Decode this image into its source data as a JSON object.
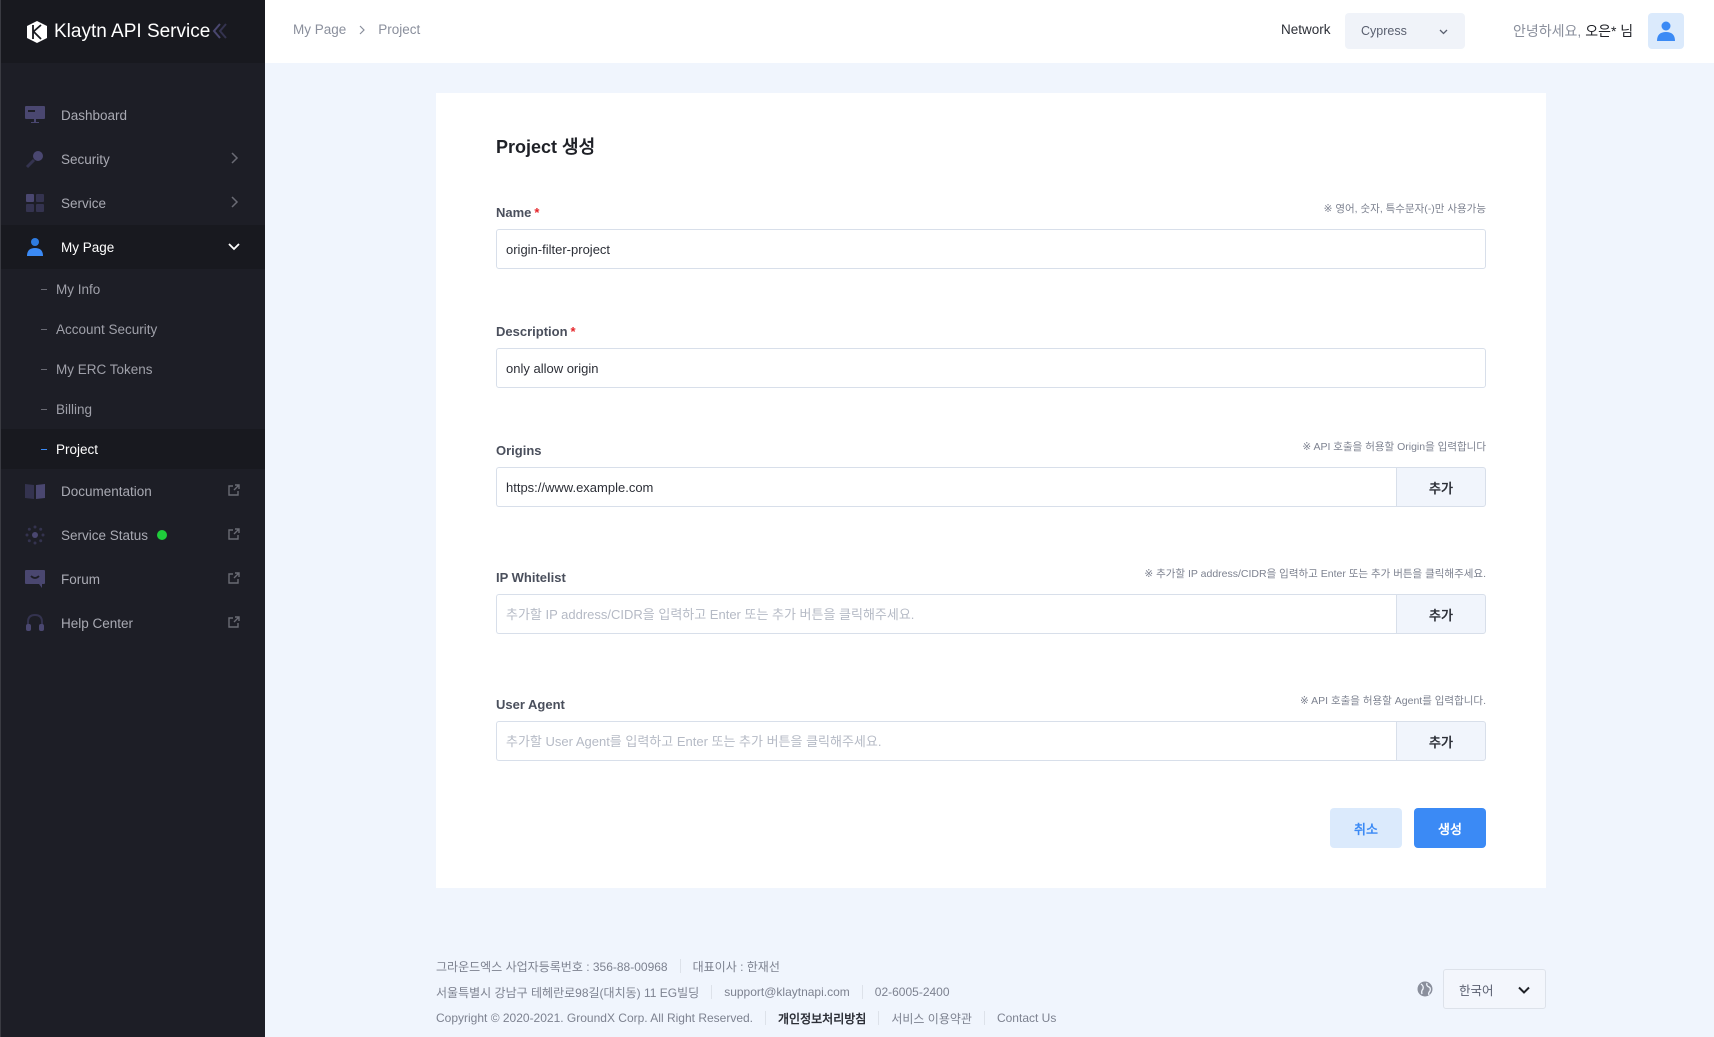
{
  "app": {
    "title": "Klaytn API Service"
  },
  "sidebar": {
    "items": [
      {
        "label": "Dashboard"
      },
      {
        "label": "Security"
      },
      {
        "label": "Service"
      },
      {
        "label": "My Page"
      }
    ],
    "subitems": [
      {
        "label": "My Info"
      },
      {
        "label": "Account Security"
      },
      {
        "label": "My ERC Tokens"
      },
      {
        "label": "Billing"
      },
      {
        "label": "Project"
      }
    ],
    "external": [
      {
        "label": "Documentation"
      },
      {
        "label": "Service Status"
      },
      {
        "label": "Forum"
      },
      {
        "label": "Help Center"
      }
    ],
    "status_color": "#1fcc3b"
  },
  "header": {
    "breadcrumb": [
      "My Page",
      "Project"
    ],
    "network_label": "Network",
    "network_value": "Cypress",
    "greeting": "안녕하세요,",
    "user_name": "오은* 님"
  },
  "form": {
    "title": "Project 생성",
    "name": {
      "label": "Name",
      "required": "*",
      "hint": "※ 영어, 숫자, 특수문자(-)만 사용가능",
      "value": "origin-filter-project"
    },
    "description": {
      "label": "Description",
      "required": "*",
      "value": "only allow origin"
    },
    "origins": {
      "label": "Origins",
      "hint": "※ API 호출을 허용할 Origin을 입력합니다",
      "value": "https://www.example.com",
      "add_label": "추가"
    },
    "ip_whitelist": {
      "label": "IP Whitelist",
      "hint": "※ 추가할 IP address/CIDR을 입력하고 Enter 또는 추가 버튼을 클릭해주세요.",
      "placeholder": "추가할 IP address/CIDR을 입력하고 Enter 또는 추가 버튼을 클릭해주세요.",
      "add_label": "추가"
    },
    "user_agent": {
      "label": "User Agent",
      "hint": "※ API 호출을 허용할 Agent를 입력합니다.",
      "placeholder": "추가할 User Agent를 입력하고 Enter 또는 추가 버튼을 클릭해주세요.",
      "add_label": "추가"
    },
    "cancel_label": "취소",
    "create_label": "생성",
    "accent": "#3b8af5"
  },
  "footer": {
    "company": "그라운드엑스 사업자등록번호 : 356-88-00968",
    "ceo": "대표이사 : 한재선",
    "address": "서울특별시 강남구 테헤란로98길(대치동) 11 EG빌딩",
    "email": "support@klaytnapi.com",
    "phone": "02-6005-2400",
    "copyright": "Copyright © 2020-2021. GroundX Corp. All Right Reserved.",
    "privacy": "개인정보처리방침",
    "terms": "서비스 이용약관",
    "contact": "Contact Us",
    "language": "한국어"
  }
}
